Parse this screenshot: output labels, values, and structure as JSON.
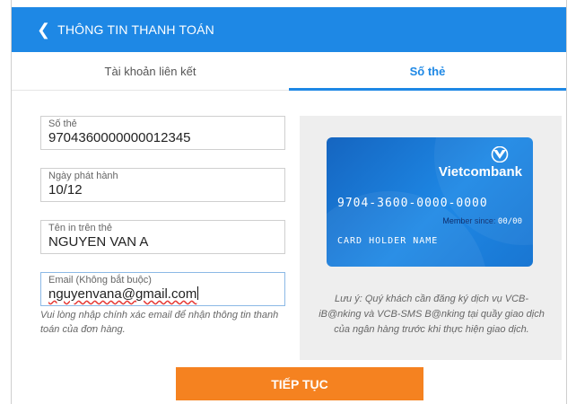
{
  "header": {
    "title": "THÔNG TIN THANH TOÁN",
    "back_icon": "chevron-left-icon"
  },
  "tabs": [
    {
      "label": "Tài khoản liên kết",
      "active": false
    },
    {
      "label": "Số thẻ",
      "active": true
    }
  ],
  "form": {
    "card_number": {
      "label": "Số thẻ",
      "value": "9704360000000012345"
    },
    "issue_date": {
      "label": "Ngày phát hành",
      "value": "10/12"
    },
    "holder_name": {
      "label": "Tên in trên thẻ",
      "value": "NGUYEN VAN A"
    },
    "email": {
      "label": "Email (Không bắt buộc)",
      "value": "nguyenvana@gmail.com"
    },
    "email_hint": "Vui lòng nhập chính xác email để nhận thông tin thanh toán của đơn hàng."
  },
  "card": {
    "bank_name": "Vietcombank",
    "number": "9704-3600-0000-0000",
    "member_since_label": "Member since:",
    "member_since_value": "00/00",
    "holder": "CARD HOLDER NAME"
  },
  "note": "Lưu ý: Quý khách cần đăng ký dịch vụ VCB-iB@nking và VCB-SMS B@nking tại quầy giao dịch của ngân hàng trước khi thực hiện giao dịch.",
  "submit_label": "TIẾP TỤC",
  "colors": {
    "primary": "#1e88e5",
    "accent": "#f58220",
    "panel": "#eeeeee"
  }
}
